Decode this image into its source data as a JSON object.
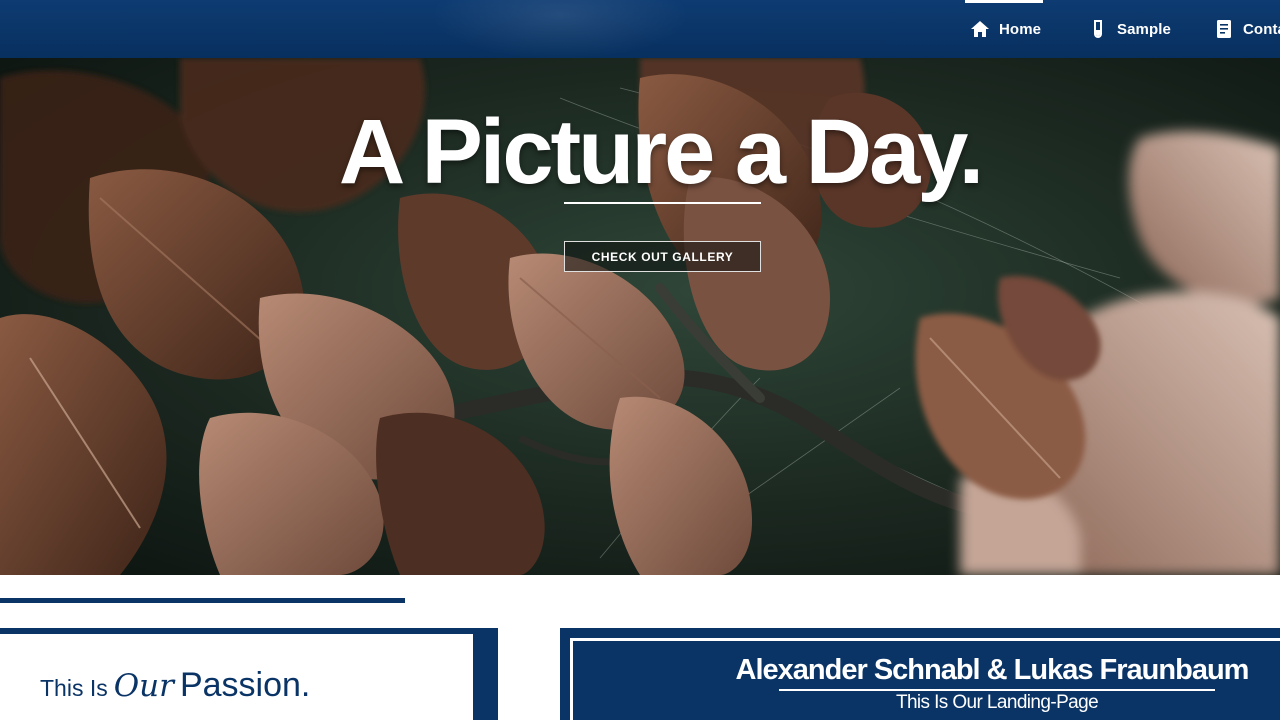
{
  "nav": {
    "items": [
      {
        "label": "Home",
        "icon": "home-icon",
        "active": true
      },
      {
        "label": "Sample",
        "icon": "test-tube-icon",
        "active": false
      },
      {
        "label": "Conta",
        "icon": "document-icon",
        "active": false
      }
    ]
  },
  "hero": {
    "title": "A Picture a Day.",
    "button_label": "CHECK OUT GALLERY"
  },
  "intro": {
    "passion_prefix": "This Is",
    "passion_script": "Our",
    "passion_word": "Passion."
  },
  "authors": {
    "names": "Alexander Schnabl & Lukas Fraunbaum",
    "tagline": "This Is Our Landing-Page"
  },
  "colors": {
    "brand_navy": "#0a3466",
    "white": "#ffffff",
    "leaf_brown": "#6b4330",
    "background_dark_green": "#1e2a22"
  }
}
